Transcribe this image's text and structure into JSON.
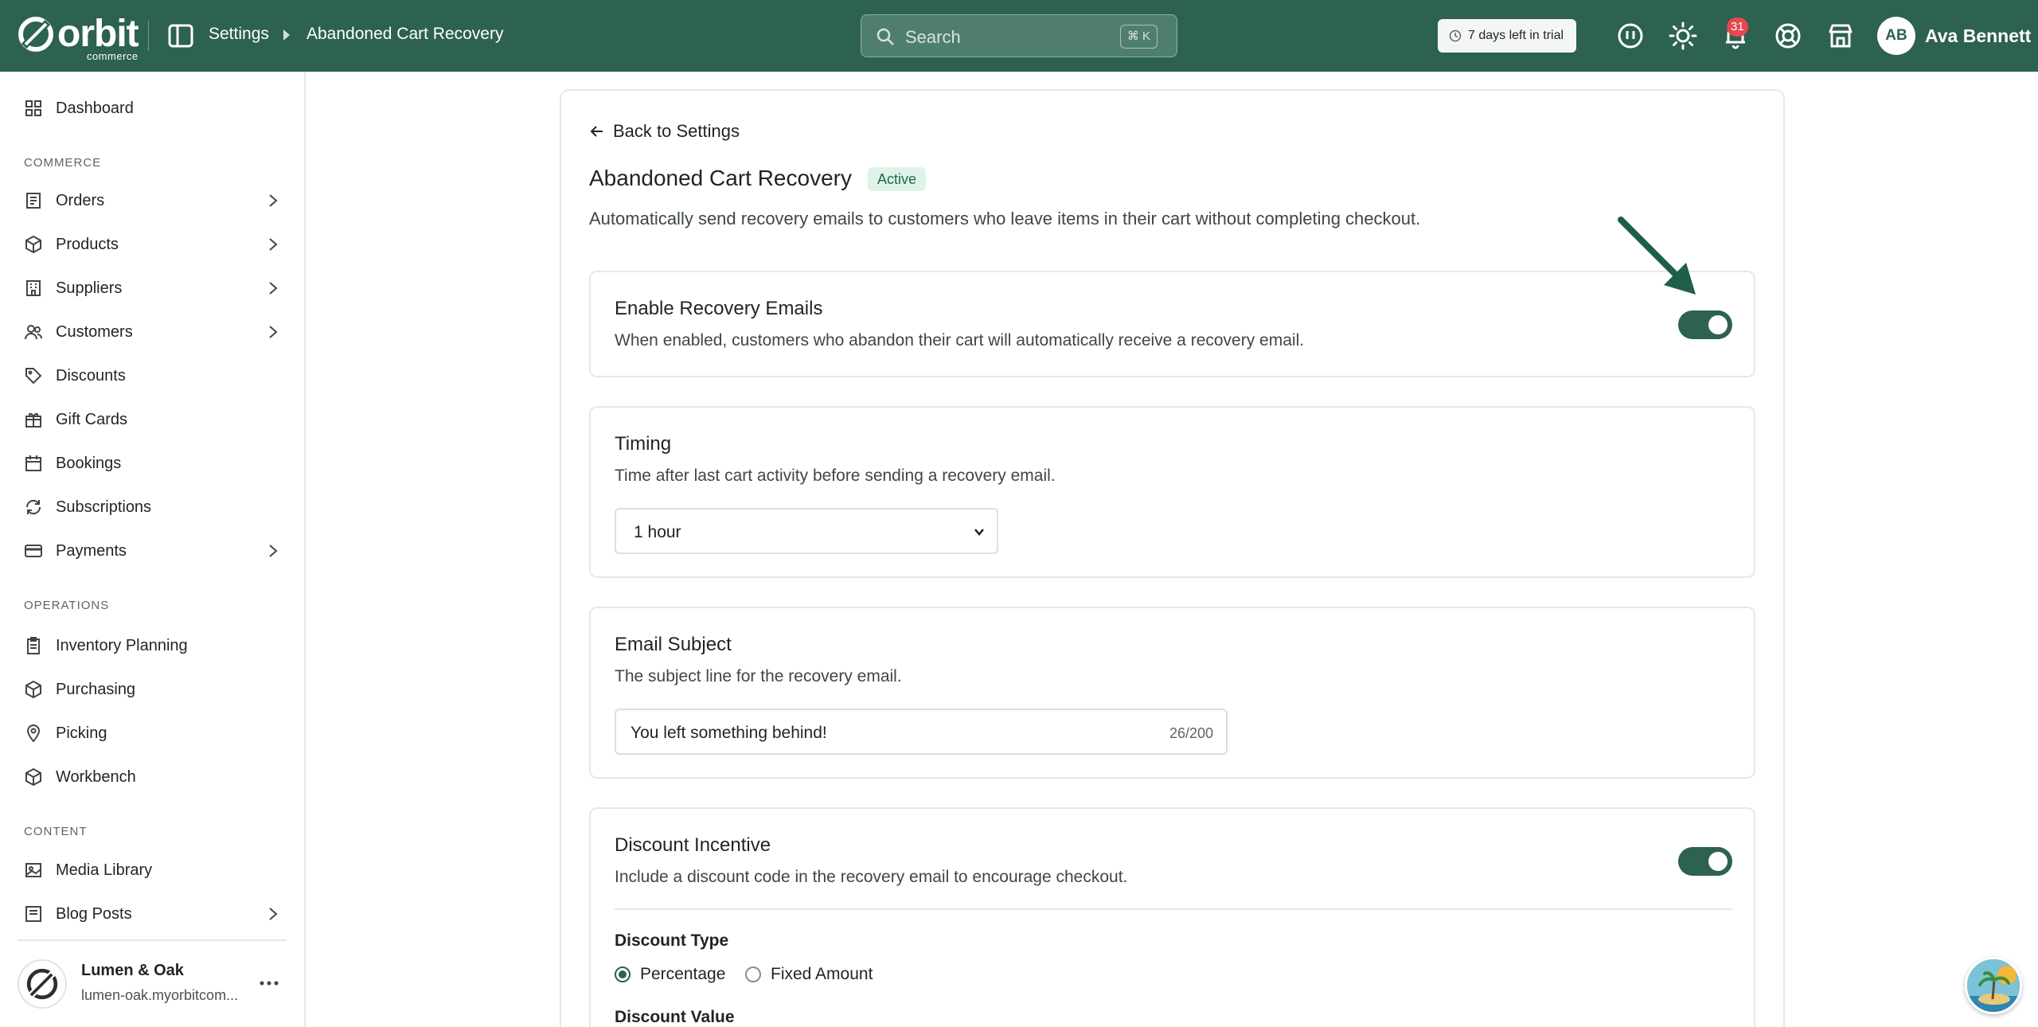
{
  "brand": {
    "logo_word": "orbit",
    "logo_sub": "commerce"
  },
  "breadcrumb": {
    "parent": "Settings",
    "current": "Abandoned Cart Recovery"
  },
  "search": {
    "placeholder": "Search",
    "shortcut": "⌘ K"
  },
  "trial": {
    "label": "7 days left in trial"
  },
  "header_icons": [
    "chat-icon",
    "sun-icon",
    "bell-icon",
    "help-icon",
    "store-icon"
  ],
  "notifications": {
    "count": "31"
  },
  "user": {
    "initials": "AB",
    "name": "Ava Bennett"
  },
  "sidebar": {
    "items": [
      {
        "label": "Dashboard",
        "icon": "dashboard-icon"
      },
      {
        "label": "Orders",
        "icon": "orders-icon",
        "chevron": true
      },
      {
        "label": "Products",
        "icon": "products-icon",
        "chevron": true
      },
      {
        "label": "Suppliers",
        "icon": "suppliers-icon",
        "chevron": true
      },
      {
        "label": "Customers",
        "icon": "customers-icon",
        "chevron": true
      },
      {
        "label": "Discounts",
        "icon": "tag-icon"
      },
      {
        "label": "Gift Cards",
        "icon": "gift-icon"
      },
      {
        "label": "Bookings",
        "icon": "calendar-icon"
      },
      {
        "label": "Subscriptions",
        "icon": "refresh-icon"
      },
      {
        "label": "Payments",
        "icon": "card-icon",
        "chevron": true
      },
      {
        "label": "Inventory Planning",
        "icon": "clipboard-icon"
      },
      {
        "label": "Purchasing",
        "icon": "box-icon"
      },
      {
        "label": "Picking",
        "icon": "pin-icon"
      },
      {
        "label": "Workbench",
        "icon": "cube-icon"
      },
      {
        "label": "Media Library",
        "icon": "image-icon"
      },
      {
        "label": "Blog Posts",
        "icon": "blog-icon",
        "chevron": true
      }
    ],
    "sections": {
      "commerce": "COMMERCE",
      "operations": "OPERATIONS",
      "content": "CONTENT"
    }
  },
  "store": {
    "name": "Lumen & Oak",
    "url": "lumen-oak.myorbitcom..."
  },
  "page": {
    "back_label": "Back to Settings",
    "title": "Abandoned Cart Recovery",
    "status": "Active",
    "description": "Automatically send recovery emails to customers who leave items in their cart without completing checkout."
  },
  "sections": {
    "enable": {
      "title": "Enable Recovery Emails",
      "description": "When enabled, customers who abandon their cart will automatically receive a recovery email.",
      "enabled": true
    },
    "timing": {
      "title": "Timing",
      "description": "Time after last cart activity before sending a recovery email.",
      "selected": "1 hour"
    },
    "subject": {
      "title": "Email Subject",
      "description": "The subject line for the recovery email.",
      "value": "You left something behind!",
      "counter": "26/200"
    },
    "discount": {
      "title": "Discount Incentive",
      "description": "Include a discount code in the recovery email to encourage checkout.",
      "enabled": true,
      "type_label": "Discount Type",
      "options": [
        "Percentage",
        "Fixed Amount"
      ],
      "selected_option": "Percentage",
      "value_label": "Discount Value"
    }
  },
  "colors": {
    "brand": "#2d6150",
    "badge": "#e5484d",
    "status_bg": "#dff3e8"
  }
}
